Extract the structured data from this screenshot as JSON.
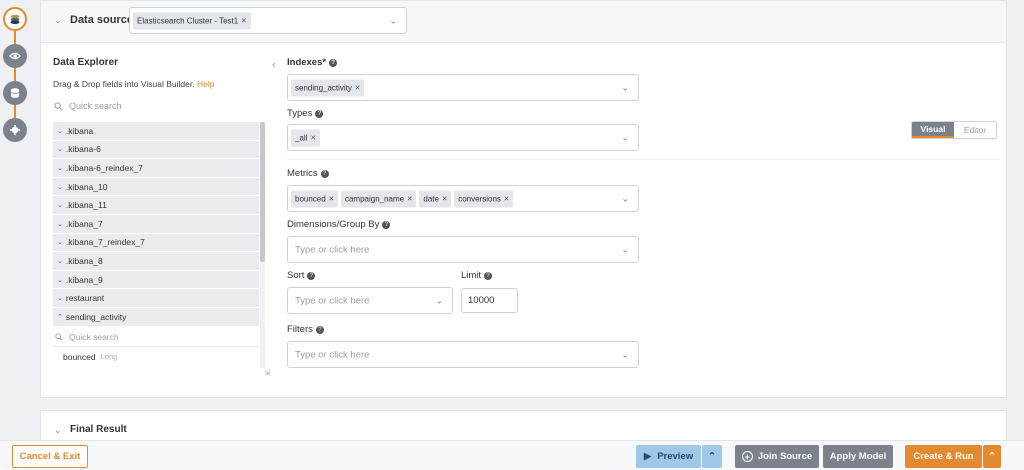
{
  "rail": {
    "icons": [
      "app-logo-icon",
      "eye-icon",
      "database-icon",
      "gear-icon"
    ]
  },
  "data_source": {
    "title": "Data source",
    "selected": "Elasticsearch Cluster - Test1"
  },
  "explorer": {
    "title": "Data Explorer",
    "subtitle": "Drag & Drop fields into Visual Builder.",
    "help": "Help",
    "search_placeholder": "Quick search",
    "items": [
      ".kibana",
      ".kibana-6",
      ".kibana-6_reindex_7",
      ".kibana_10",
      ".kibana_11",
      ".kibana_7",
      ".kibana_7_reindex_7",
      ".kibana_8",
      ".kibana_9",
      "restaurant",
      "sending_activity"
    ],
    "sub_search_placeholder": "Quick search",
    "fields": [
      {
        "name": "bounced",
        "type": "Long"
      }
    ]
  },
  "form": {
    "indexes_label": "Indexes*",
    "indexes": [
      "sending_activity"
    ],
    "types_label": "Types",
    "types": [
      "_all"
    ],
    "metrics_label": "Metrics",
    "metrics": [
      "bounced",
      "campaign_name",
      "date",
      "conversions"
    ],
    "dimensions_label": "Dimensions/Group By",
    "dimensions_placeholder": "Type or click here",
    "sort_label": "Sort",
    "sort_placeholder": "Type or click here",
    "limit_label": "Limit",
    "limit_value": "10000",
    "filters_label": "Filters",
    "filters_placeholder": "Type or click here"
  },
  "mode_toggle": {
    "visual": "Visual",
    "editor": "Editor",
    "active": "Visual"
  },
  "final_result": {
    "title": "Final Result"
  },
  "footer": {
    "cancel": "Cancel & Exit",
    "preview": "Preview",
    "join_source": "Join Source",
    "apply_model": "Apply Model",
    "create_run": "Create & Run"
  },
  "colors": {
    "accent": "#e38a2f",
    "rail": "#7b828c",
    "preview": "#9ec7e8"
  }
}
